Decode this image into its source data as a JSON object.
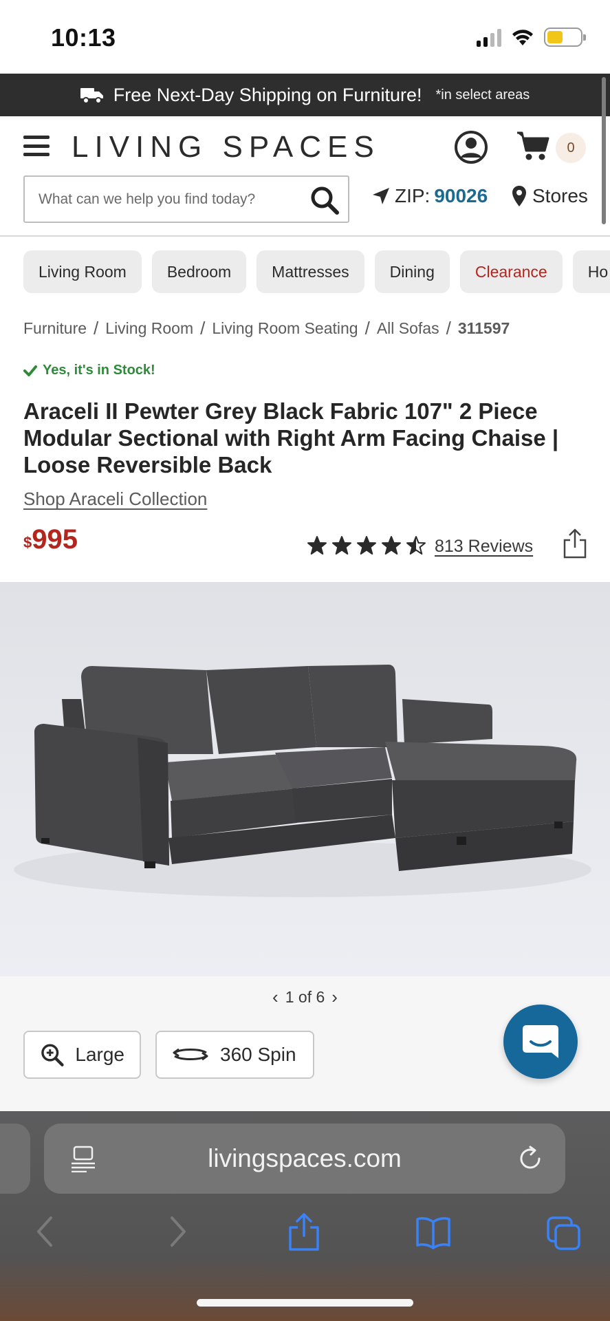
{
  "status_bar": {
    "time": "10:13"
  },
  "promo": {
    "text": "Free Next-Day Shipping on Furniture!",
    "note": "*in select areas"
  },
  "header": {
    "logo": "LIVING SPACES",
    "cart_count": "0",
    "search_placeholder": "What can we help you find today?",
    "zip_label": "ZIP:",
    "zip_value": "90026",
    "stores_label": "Stores"
  },
  "categories": [
    "Living Room",
    "Bedroom",
    "Mattresses",
    "Dining",
    "Clearance",
    "Ho"
  ],
  "breadcrumb": [
    "Furniture",
    "Living Room",
    "Living Room Seating",
    "All Sofas",
    "311597"
  ],
  "product": {
    "stock": "Yes, it's in Stock!",
    "title": "Araceli II Pewter Grey Black Fabric 107\" 2 Piece Modular Sectional with Right Arm Facing Chaise | Loose Reversible Back",
    "collection_link": "Shop Araceli Collection",
    "price_currency": "$",
    "price": "995",
    "rating": 4.5,
    "reviews": "813 Reviews"
  },
  "gallery": {
    "pager": "1 of 6",
    "zoom_label": "Large",
    "spin_label": "360 Spin"
  },
  "browser": {
    "url": "livingspaces.com"
  },
  "colors": {
    "promo_bg": "#2e2e2e",
    "price": "#b3261e",
    "stock": "#2e8b3a",
    "zip": "#1b6a92",
    "chat": "#17689a",
    "safari_blue": "#3b82f6"
  }
}
